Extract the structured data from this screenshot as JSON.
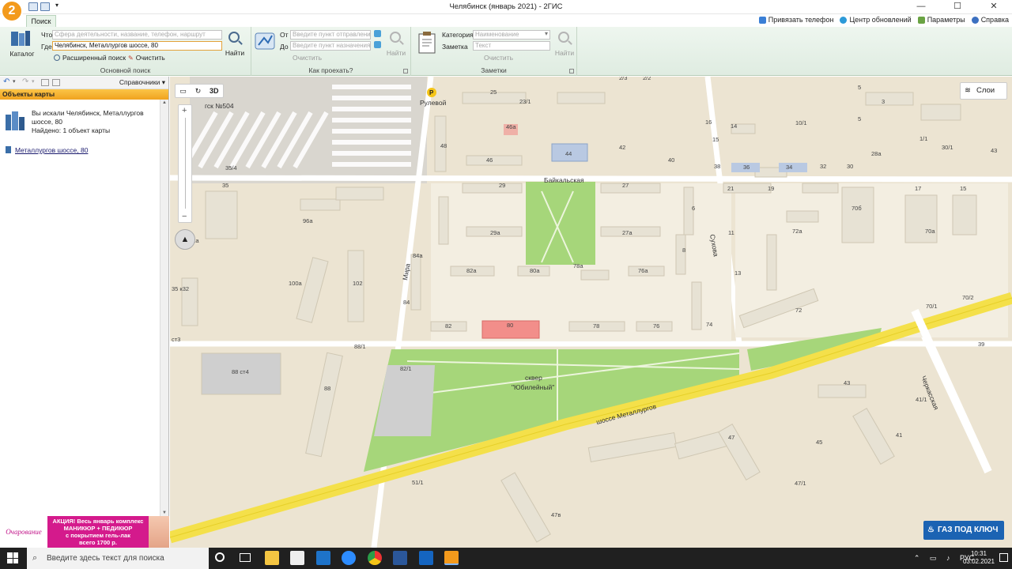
{
  "app": {
    "logo": "2",
    "title": "Челябинск (январь 2021) - 2ГИС"
  },
  "window_buttons": [
    "—",
    "☐",
    "✕"
  ],
  "tabs": {
    "search": "Поиск"
  },
  "toplinks": {
    "phone": "Привязать телефон",
    "updates": "Центр обновлений",
    "settings": "Параметры",
    "help": "Справка"
  },
  "main_search": {
    "catalog": "Каталог",
    "what_label": "Что",
    "what_placeholder": "Сфера деятельности, название, телефон, наршрут",
    "where_label": "Где",
    "where_value": "Челябинск, Металлургов шоссе, 80",
    "find": "Найти",
    "advanced": "Расширенный поиск",
    "clear": "Очистить",
    "group_label": "Основной поиск"
  },
  "route": {
    "from_label": "От",
    "from_placeholder": "Введите пункт отправления",
    "to_label": "До",
    "to_placeholder": "Введите пункт назначения",
    "find": "Найти",
    "clear": "Очистить",
    "group_label": "Как проехать?"
  },
  "notes": {
    "category_label": "Категория",
    "category_placeholder": "Наименование",
    "note_label": "Заметка",
    "note_placeholder": "Текст",
    "find": "Найти",
    "clear": "Очистить",
    "group_label": "Заметки"
  },
  "panel": {
    "directories": "Справочники",
    "header": "Объекты карты",
    "result_line1": "Вы искали Челябинск, Металлургов",
    "result_line2": "шоссе, 80",
    "result_found": "Найдено: 1 объект карты",
    "result_link": "Металлургов шоссе, 80"
  },
  "ad": {
    "brand": "Очарование",
    "line1": "АКЦИЯ! Весь январь комплекс",
    "line2": "МАНИКЮР + ПЕДИКЮР",
    "line3": "с покрытием гель-лак",
    "line4": "всего 1700 р."
  },
  "map": {
    "mode_3d": "3D",
    "layers": "Слои",
    "streets": {
      "metallurgov": "шоссе Металлургов",
      "mira": "Мира",
      "baikalskaya": "Байкальская",
      "cherkasskaya": "Черкасская",
      "suhova": "Сухова",
      "rulevoy": "Рулевой",
      "gsk": "гск №504"
    },
    "park": {
      "line1": "сквер",
      "line2": "\"Юбилейный\""
    },
    "labels": [
      "25",
      "23/1",
      "46а",
      "44",
      "42",
      "40",
      "46",
      "48",
      "29",
      "27",
      "29а",
      "27а",
      "84а",
      "82а",
      "80а",
      "78а",
      "76а",
      "84",
      "82",
      "80",
      "78",
      "76",
      "74",
      "96а",
      "100а",
      "102",
      "88 ст4",
      "88",
      "88/1",
      "82/1",
      "51/1",
      "47в",
      "47",
      "47/1",
      "45",
      "41",
      "41/1",
      "43",
      "39",
      "70/1",
      "70/2",
      "72",
      "72а",
      "70а",
      "70б",
      "36",
      "34",
      "32",
      "30",
      "21",
      "19",
      "17",
      "13",
      "11",
      "16",
      "14",
      "10/1",
      "15",
      "6",
      "8",
      "38",
      "35/4",
      "35",
      "32а",
      "35 к32",
      "6",
      "5",
      "2/3",
      "2/2",
      "1/1",
      "30/1",
      "43",
      "ст3"
    ],
    "promo": "ГАЗ ПОД КЛЮЧ"
  },
  "taskbar": {
    "search_placeholder": "Введите здесь текст для поиска",
    "lang": "РУС",
    "time": "10:31",
    "date": "03.02.2021"
  }
}
